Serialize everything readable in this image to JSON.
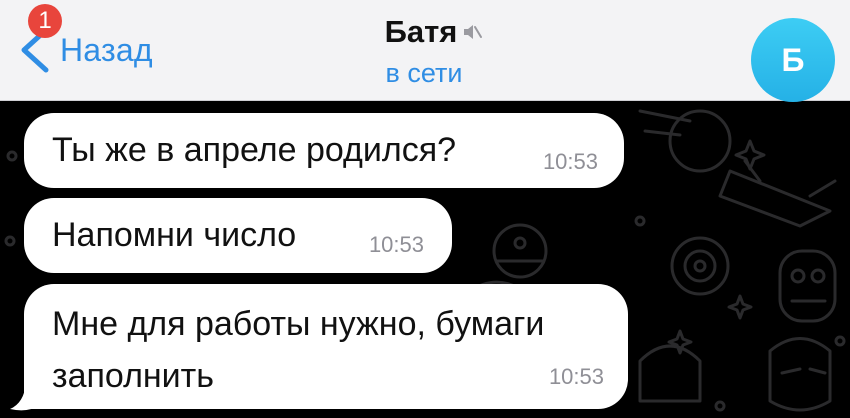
{
  "header": {
    "back_label": "Назад",
    "unread_count": "1",
    "title": "Батя",
    "status": "в сети",
    "avatar_letter": "Б",
    "muted": true
  },
  "messages": [
    {
      "text": "Ты же в апреле родился?",
      "time": "10:53"
    },
    {
      "text": "Напомни число",
      "time": "10:53"
    },
    {
      "text": "Мне для работы нужно, бумаги заполнить",
      "time": "10:53"
    }
  ],
  "colors": {
    "accent": "#2f8de4",
    "badge": "#e8453c",
    "avatar": "#2ebce9",
    "wallpaper": "#000000",
    "bubble": "#ffffff"
  },
  "icons": [
    "chevron-left-icon",
    "mute-icon",
    "doodle-wallpaper"
  ]
}
